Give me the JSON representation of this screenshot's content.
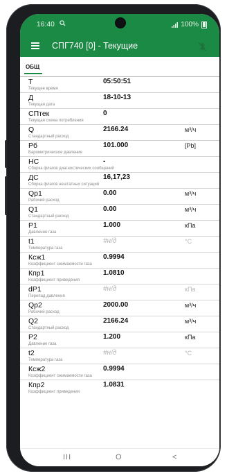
{
  "status": {
    "time": "16:40",
    "battery": "100%"
  },
  "appbar": {
    "title": "СПГ740 [0] - Текущие"
  },
  "tabs": [
    {
      "label": "ОБЩ"
    }
  ],
  "rows": [
    {
      "name": "T",
      "desc": "Текущее время",
      "value": "05:50:51",
      "unit": "",
      "na": false
    },
    {
      "name": "Д",
      "desc": "Текущая дата",
      "value": "18-10-13",
      "unit": "",
      "na": false
    },
    {
      "name": "СПтек",
      "desc": "Текущая схема потребления",
      "value": "0",
      "unit": "",
      "na": false
    },
    {
      "name": "Q",
      "desc": "Стандартный расход",
      "value": "2166.24",
      "unit": "м³/ч",
      "na": false
    },
    {
      "name": "Рб",
      "desc": "Барометрическое давление",
      "value": "101.000",
      "unit": "[Pb]",
      "na": false
    },
    {
      "name": "НС",
      "desc": "Сборка флагов диагностических сообщений",
      "value": "-",
      "unit": "",
      "na": false
    },
    {
      "name": "ДС",
      "desc": "Сборка флагов нештатных ситуаций",
      "value": "16,17,23",
      "unit": "",
      "na": false
    },
    {
      "name": "Qр1",
      "desc": "Рабочий расход",
      "value": "0.00",
      "unit": "м³/ч",
      "na": false
    },
    {
      "name": "Q1",
      "desc": "Стандартный расход",
      "value": "0.00",
      "unit": "м³/ч",
      "na": false
    },
    {
      "name": "P1",
      "desc": "Давление газа",
      "value": "1.000",
      "unit": "кПа",
      "na": false
    },
    {
      "name": "t1",
      "desc": "Температура газа",
      "value": "#н/д",
      "unit": "°C",
      "na": true
    },
    {
      "name": "Ксж1",
      "desc": "Коэффициент сжимаемости газа",
      "value": "0.9994",
      "unit": "",
      "na": false
    },
    {
      "name": "Кпр1",
      "desc": "Коэффициент приведения",
      "value": "1.0810",
      "unit": "",
      "na": false
    },
    {
      "name": "dP1",
      "desc": "Перепад давления",
      "value": "#н/д",
      "unit": "кПа",
      "na": true
    },
    {
      "name": "Qр2",
      "desc": "Рабочий расход",
      "value": "2000.00",
      "unit": "м³/ч",
      "na": false
    },
    {
      "name": "Q2",
      "desc": "Стандартный расход",
      "value": "2166.24",
      "unit": "м³/ч",
      "na": false
    },
    {
      "name": "P2",
      "desc": "Давление газа",
      "value": "1.200",
      "unit": "кПа",
      "na": false
    },
    {
      "name": "t2",
      "desc": "Температура газа",
      "value": "#н/д",
      "unit": "°C",
      "na": true
    },
    {
      "name": "Ксж2",
      "desc": "Коэффициент сжимаемости газа",
      "value": "0.9994",
      "unit": "",
      "na": false
    },
    {
      "name": "Кпр2",
      "desc": "Коэффициент приведения",
      "value": "1.0831",
      "unit": "",
      "na": false
    }
  ],
  "navbar": {
    "recent": "III",
    "home": "O",
    "back": "<"
  },
  "colors": {
    "accent": "#1b8a45",
    "na_text": "#b0b0b0"
  }
}
